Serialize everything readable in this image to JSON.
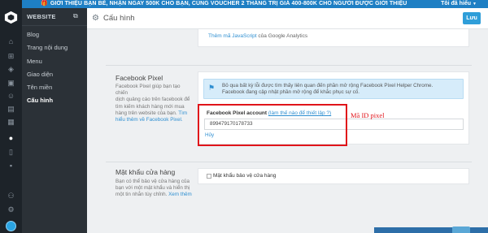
{
  "topbar": {
    "promo": "GIỚI THIỆU BẠN BÈ, NHẬN NGAY 500K CHO BẠN, CÙNG VOUCHER 2 THÁNG TRỊ GIÁ 400-800K CHO NGƯỜI ĐƯỢC GIỚI THIỆU",
    "account": "Tôi đã hiểu"
  },
  "sidebar": {
    "title": "WEBSITE",
    "items": [
      {
        "label": "Blog"
      },
      {
        "label": "Trang nội dung"
      },
      {
        "label": "Menu"
      },
      {
        "label": "Giao diện"
      },
      {
        "label": "Tên miền"
      },
      {
        "label": "Cấu hình"
      }
    ]
  },
  "header": {
    "title": "Cấu hình",
    "save_label": "Lưu"
  },
  "ga": {
    "link_text": "Thêm mã JavaScript",
    "rest_text": " của Google Analytics"
  },
  "facebook_pixel": {
    "title": "Facebook Pixel",
    "desc_line1": "Facebook Pixel giúp bạn tạo chiến",
    "desc_line2": "dịch quảng cáo trên facebook để",
    "desc_line3": "tìm kiếm khách hàng mới mua",
    "desc_line4": "hàng trên website của bạn.",
    "desc_link1": "Tìm",
    "desc_link2": "hiểu thêm về Facebook Pixel.",
    "info_line1": "Bỏ qua bất kỳ lỗi được tìm thấy liên quan đến phần mở rộng Facebook Pixel Helper Chrome.",
    "info_line2": "Facebook đang cập nhật phần mở rộng để khắc phục sự cố.",
    "field_label": "Facebook Pixel account",
    "help_link": "(làm thế nào để thiết lập ?)",
    "value": "899479170178733",
    "cancel_link": "Hủy",
    "annotation": "Mã ID pixel"
  },
  "password": {
    "title": "Mật khẩu cửa hàng",
    "desc_line1": "Bạn có thể bảo vệ cửa hàng của",
    "desc_line2": "bạn với một mật khẩu và hiển thị",
    "desc_line3": "một tin nhắn tùy chỉnh.",
    "desc_link": "Xem thêm",
    "checkbox_label": "Mật khẩu bảo vệ cửa hàng"
  },
  "colors": {
    "accent": "#2f9ed9",
    "annotation": "#e0141a",
    "sidebar_bg": "#2b3137"
  }
}
